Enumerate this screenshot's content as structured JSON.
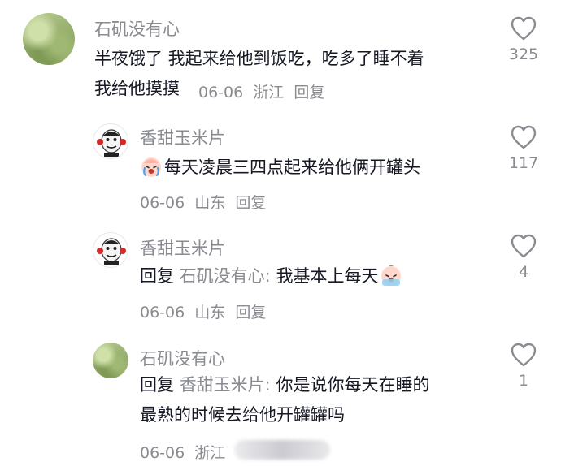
{
  "comments": [
    {
      "username": "石矶没有心",
      "lines": [
        "半夜饿了 我起来给他到饭吃，吃多了睡不着",
        "我给他摸摸"
      ],
      "date": "06-06",
      "location": "浙江",
      "reply_label": "回复",
      "likes": "325"
    },
    {
      "username": "香甜玉米片",
      "text": "每天凌晨三四点起来给他俩开罐头",
      "date": "06-06",
      "location": "山东",
      "reply_label": "回复",
      "likes": "117"
    },
    {
      "username": "香甜玉米片",
      "reply_prefix": "回复",
      "reply_to": "石矶没有心:",
      "text": "我基本上每天",
      "date": "06-06",
      "location": "山东",
      "reply_label": "回复",
      "likes": "4"
    },
    {
      "username": "石矶没有心",
      "reply_prefix": "回复",
      "reply_to": "香甜玉米片:",
      "text": "你是说你每天在睡的",
      "line2": "最熟的时候去给他开罐罐吗",
      "date": "06-06",
      "location": "浙江",
      "likes": "1"
    }
  ],
  "icons": {
    "like": "heart-outline-icon",
    "crying_emoji": "crying-emoji-icon",
    "sweating_emoji": "sweating-emoji-icon"
  },
  "colors": {
    "text": "#161823",
    "secondary": "#8a8b91",
    "background": "#ffffff"
  }
}
